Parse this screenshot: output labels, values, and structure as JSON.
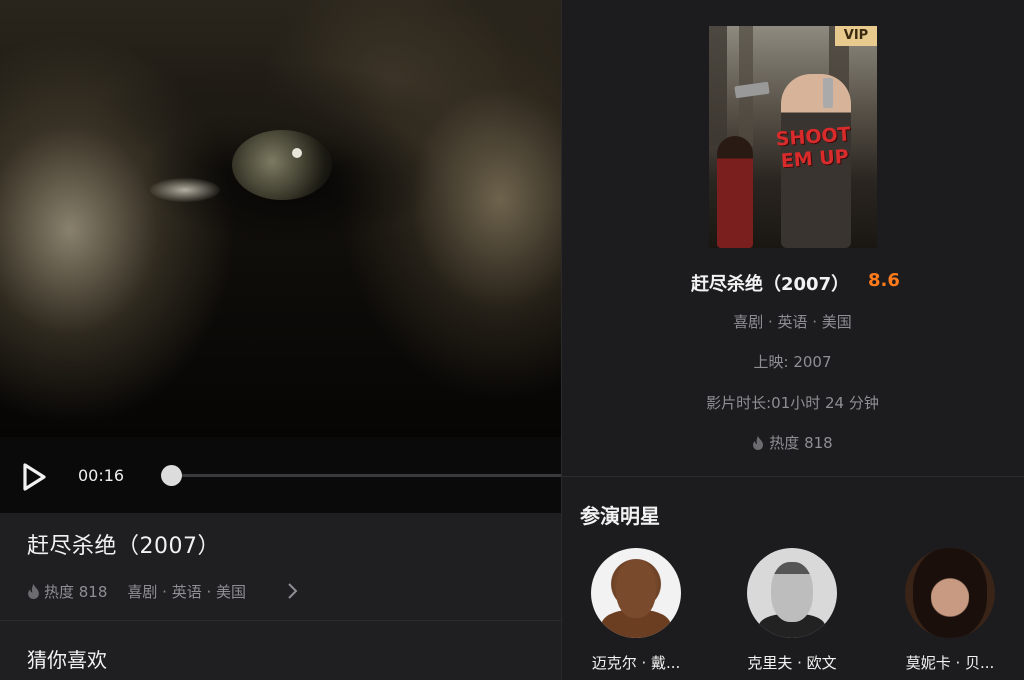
{
  "player": {
    "current_time": "00:16",
    "progress": 0.0
  },
  "left": {
    "title": "赶尽杀绝（2007）",
    "heat": "热度 818",
    "genre": "喜剧 · 英语 · 美国",
    "guess_title": "猜你喜欢"
  },
  "poster": {
    "vip_label": "VIP",
    "poster_text": "SHOOT EM UP"
  },
  "detail": {
    "title": "赶尽杀绝（2007）",
    "score": "8.6",
    "score_color": "#ff7a1a",
    "genre": "喜剧 · 英语 · 美国",
    "release": "上映: 2007",
    "duration": "影片时长:01小时 24 分钟",
    "heat": "热度 818"
  },
  "cast": {
    "title": "参演明星",
    "members": [
      {
        "name": "迈克尔 · 戴..."
      },
      {
        "name": "克里夫 · 欧文"
      },
      {
        "name": "莫妮卡 · 贝..."
      }
    ]
  },
  "icons": {
    "play": "play-icon",
    "flame": "flame-icon",
    "chevron": "chevron-right-icon"
  },
  "colors": {
    "accent_score": "#ff7a1a",
    "vip_bg": "#e8c98e",
    "background": "#1c1c1e"
  }
}
